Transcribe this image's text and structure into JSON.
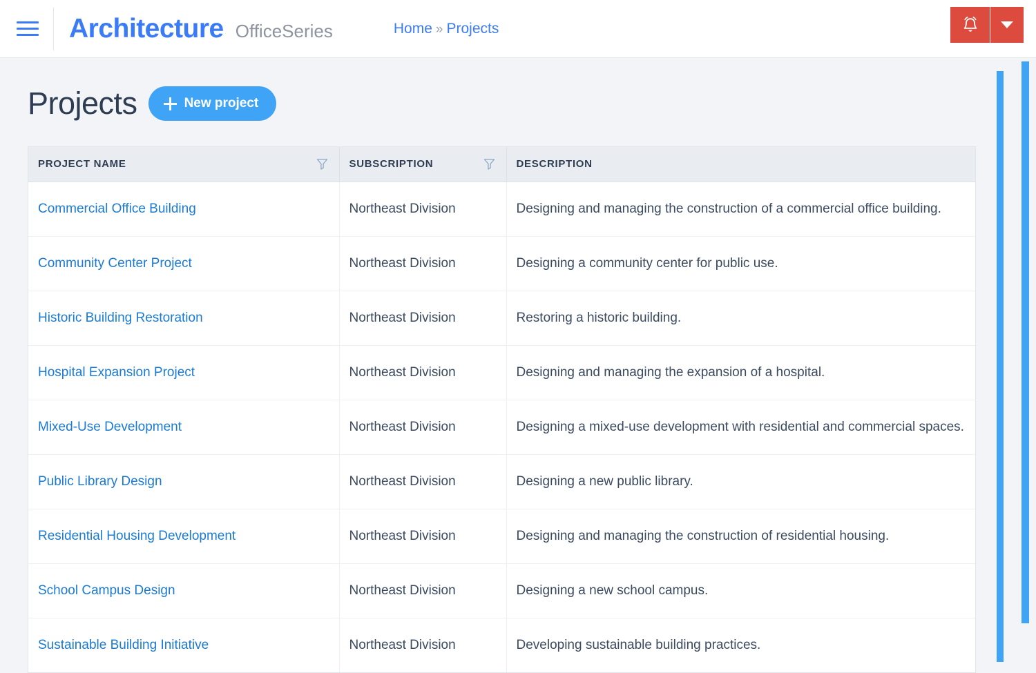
{
  "header": {
    "menu_icon": "hamburger-icon",
    "brand": "Architecture",
    "brand_suffix": "OfficeSeries",
    "breadcrumb": {
      "home": "Home",
      "separator": "»",
      "current": "Projects"
    },
    "notifications_icon": "bell-icon",
    "dropdown_icon": "caret-down-icon",
    "accent_red": "#dd4b3e",
    "accent_blue": "#3b7bf6"
  },
  "page": {
    "title": "Projects",
    "new_project_label": "New project",
    "new_project_icon": "plus-icon",
    "accent_button": "#3fa3f6"
  },
  "table": {
    "columns": [
      {
        "label": "PROJECT NAME",
        "filter_icon": "filter-funnel-icon",
        "filterable": true
      },
      {
        "label": "SUBSCRIPTION",
        "filter_icon": "filter-funnel-icon",
        "filterable": true
      },
      {
        "label": "DESCRIPTION",
        "filter_icon": null,
        "filterable": false
      }
    ],
    "rows": [
      {
        "name": "Commercial Office Building",
        "subscription": "Northeast Division",
        "description": "Designing and managing the construction of a commercial office building."
      },
      {
        "name": "Community Center Project",
        "subscription": "Northeast Division",
        "description": "Designing a community center for public use."
      },
      {
        "name": "Historic Building Restoration",
        "subscription": "Northeast Division",
        "description": "Restoring a historic building."
      },
      {
        "name": "Hospital Expansion Project",
        "subscription": "Northeast Division",
        "description": "Designing and managing the expansion of a hospital."
      },
      {
        "name": "Mixed-Use Development",
        "subscription": "Northeast Division",
        "description": "Designing a mixed-use development with residential and commercial spaces."
      },
      {
        "name": "Public Library Design",
        "subscription": "Northeast Division",
        "description": "Designing a new public library."
      },
      {
        "name": "Residential Housing Development",
        "subscription": "Northeast Division",
        "description": "Designing and managing the construction of residential housing."
      },
      {
        "name": "School Campus Design",
        "subscription": "Northeast Division",
        "description": "Designing a new school campus."
      },
      {
        "name": "Sustainable Building Initiative",
        "subscription": "Northeast Division",
        "description": "Developing sustainable building practices."
      }
    ]
  },
  "scrollbars": {
    "inner_color": "#3fa3f6",
    "outer_color": "#3fa3f6"
  }
}
